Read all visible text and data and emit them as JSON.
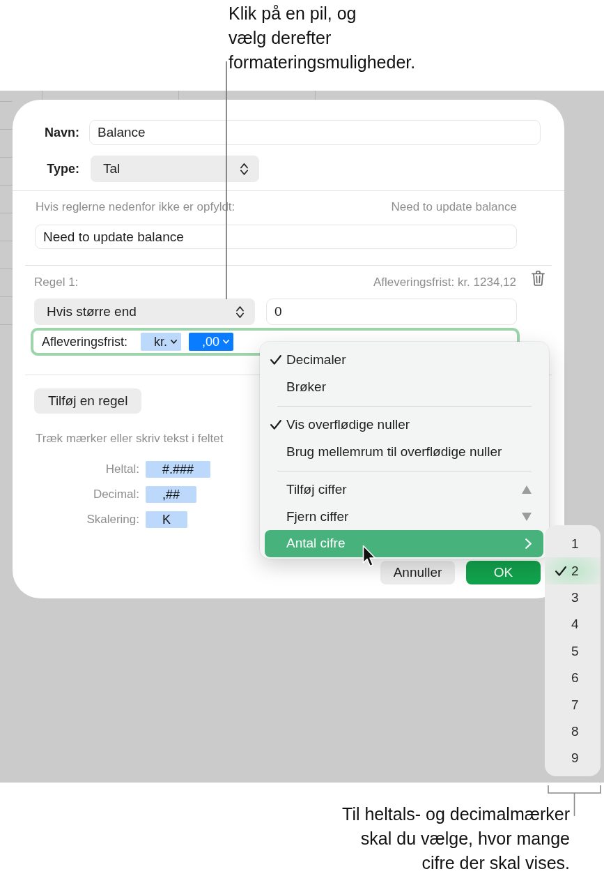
{
  "callout_top": {
    "lines": [
      "Klik på en pil, og",
      "vælg derefter",
      "formateringsmuligheder."
    ]
  },
  "dialog": {
    "name": {
      "label": "Navn:",
      "value": "Balance"
    },
    "type": {
      "label": "Type:",
      "value": "Tal"
    },
    "fallback": {
      "label": "Hvis reglerne nedenfor ikke er opfyldt:",
      "preview": "Need to update balance",
      "value": "Need to update balance"
    },
    "rule": {
      "label": "Regel 1:",
      "preview": "Afleveringsfrist: kr. 1234,12",
      "condition": "Hvis større end",
      "value": "0",
      "format": {
        "focused": true,
        "text": "Afleveringsfrist:",
        "tokens": [
          {
            "label": "kr.",
            "selected": false
          },
          {
            "label": ",00",
            "selected": true
          }
        ]
      }
    },
    "add_rule_button": "Tilføj en regel",
    "hint": "Træk mærker eller skriv tekst i feltet",
    "token_rows": [
      {
        "label": "Heltal:",
        "token": "#.###"
      },
      {
        "label": "Decimal:",
        "token": ",##"
      },
      {
        "label": "Skalering:",
        "token": "K"
      }
    ],
    "buttons": [
      {
        "label": "Annuller",
        "kind": "secondary"
      },
      {
        "label": "OK",
        "kind": "primary"
      }
    ]
  },
  "menu": {
    "groups": [
      {
        "items": [
          {
            "label": "Decimaler",
            "kind": "plain",
            "checked": true,
            "selected": false
          },
          {
            "label": "Brøker",
            "kind": "plain",
            "checked": false,
            "selected": false
          }
        ]
      },
      {
        "items": [
          {
            "label": "Vis overflødige nuller",
            "kind": "plain",
            "checked": true,
            "selected": false
          },
          {
            "label": "Brug mellemrum til overflødige nuller",
            "kind": "plain",
            "checked": false,
            "selected": false
          }
        ]
      },
      {
        "items": [
          {
            "label": "Tilføj ciffer",
            "kind": "step_up",
            "checked": false,
            "selected": false
          },
          {
            "label": "Fjern ciffer",
            "kind": "step_down",
            "checked": false,
            "selected": false
          },
          {
            "label": "Antal cifre",
            "kind": "submenu",
            "checked": false,
            "selected": true
          }
        ]
      }
    ]
  },
  "submenu": {
    "items": [
      {
        "label": "1",
        "checked": false,
        "selected": false
      },
      {
        "label": "2",
        "checked": true,
        "selected": true
      },
      {
        "label": "3",
        "checked": false,
        "selected": false
      },
      {
        "label": "4",
        "checked": false,
        "selected": false
      },
      {
        "label": "5",
        "checked": false,
        "selected": false
      },
      {
        "label": "6",
        "checked": false,
        "selected": false
      },
      {
        "label": "7",
        "checked": false,
        "selected": false
      },
      {
        "label": "8",
        "checked": false,
        "selected": false
      },
      {
        "label": "9",
        "checked": false,
        "selected": false
      }
    ]
  },
  "callout_bottom": {
    "lines": [
      "Til heltals- og decimalmærker",
      "skal du vælge, hvor mange",
      "cifre der skal vises."
    ]
  }
}
